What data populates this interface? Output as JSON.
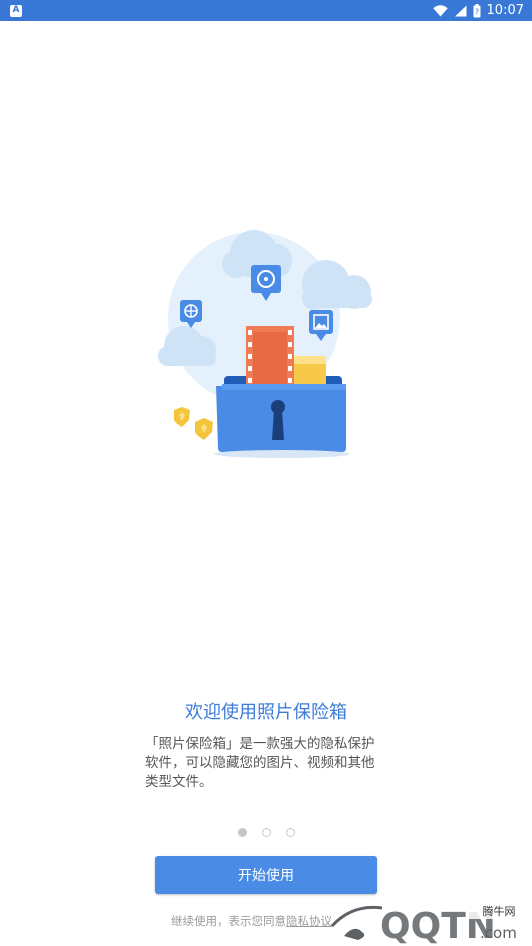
{
  "status_bar": {
    "notification_icon": "app-notification-icon",
    "notification_glyph": "A",
    "wifi_icon": "wifi-icon",
    "signal_icon": "signal-icon",
    "battery_icon": "battery-icon",
    "time": "10:07"
  },
  "illustration": {
    "icon": "locked-folder-illustration",
    "colors": {
      "background_circle": "#e4f0fb",
      "clouds": "#cfe3f7",
      "folder_front": "#4a8be6",
      "folder_back": "#1f5db8",
      "film_strip": "#f07a55",
      "document": "#f6c94a",
      "badge": "#4a8be6",
      "shields": "#f3c53c"
    }
  },
  "welcome": {
    "title": "欢迎使用照片保险箱",
    "description_line1": "「照片保险箱」是一款强大的隐私保护",
    "description_line2": "软件，可以隐藏您的图片、视频和其他",
    "description_line3": "类型文件。"
  },
  "pager": {
    "active_index": 0,
    "count": 3
  },
  "start_button": {
    "label": "开始使用",
    "color": "#4a8be6"
  },
  "consent": {
    "prefix": "继续使用，表示您同意",
    "link": "隐私协议"
  },
  "watermark": {
    "brand": "QQTN",
    "domain": ".com",
    "site_label": "腾牛网"
  },
  "colors": {
    "status_bar": "#3a78d8",
    "accent": "#3c7bd8",
    "body_text": "#555555",
    "muted_text": "#9a9a9a"
  }
}
